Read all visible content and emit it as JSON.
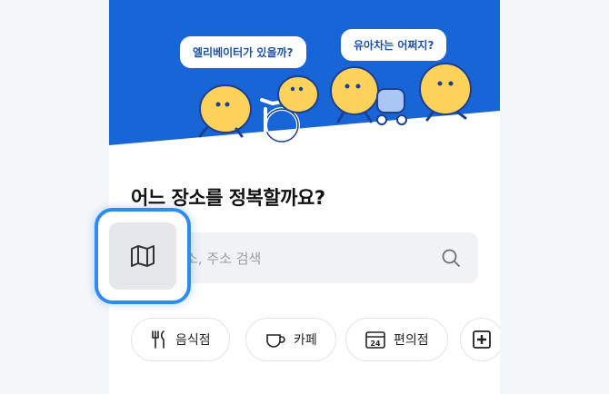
{
  "hero": {
    "bubble_elevator": "엘리베이터가 있을까?",
    "bubble_stroller": "유아차는 어쩌지?"
  },
  "main": {
    "question": "어느 장소를 정복할까요?"
  },
  "search": {
    "placeholder": "소, 주소 검색"
  },
  "categories": [
    {
      "label": "음식점",
      "icon": "fork-knife-icon"
    },
    {
      "label": "카페",
      "icon": "coffee-cup-icon"
    },
    {
      "label": "편의점",
      "icon": "convenience-store-24-icon",
      "icon_text": "24"
    },
    {
      "label": "",
      "icon": "plus-box-icon"
    }
  ],
  "map_button": {
    "icon": "map-icon"
  },
  "colors": {
    "hero_blue": "#1865d8",
    "character_yellow": "#fdd25b",
    "highlight_border": "#2f8bf0",
    "search_bg": "#f1f2f4"
  }
}
